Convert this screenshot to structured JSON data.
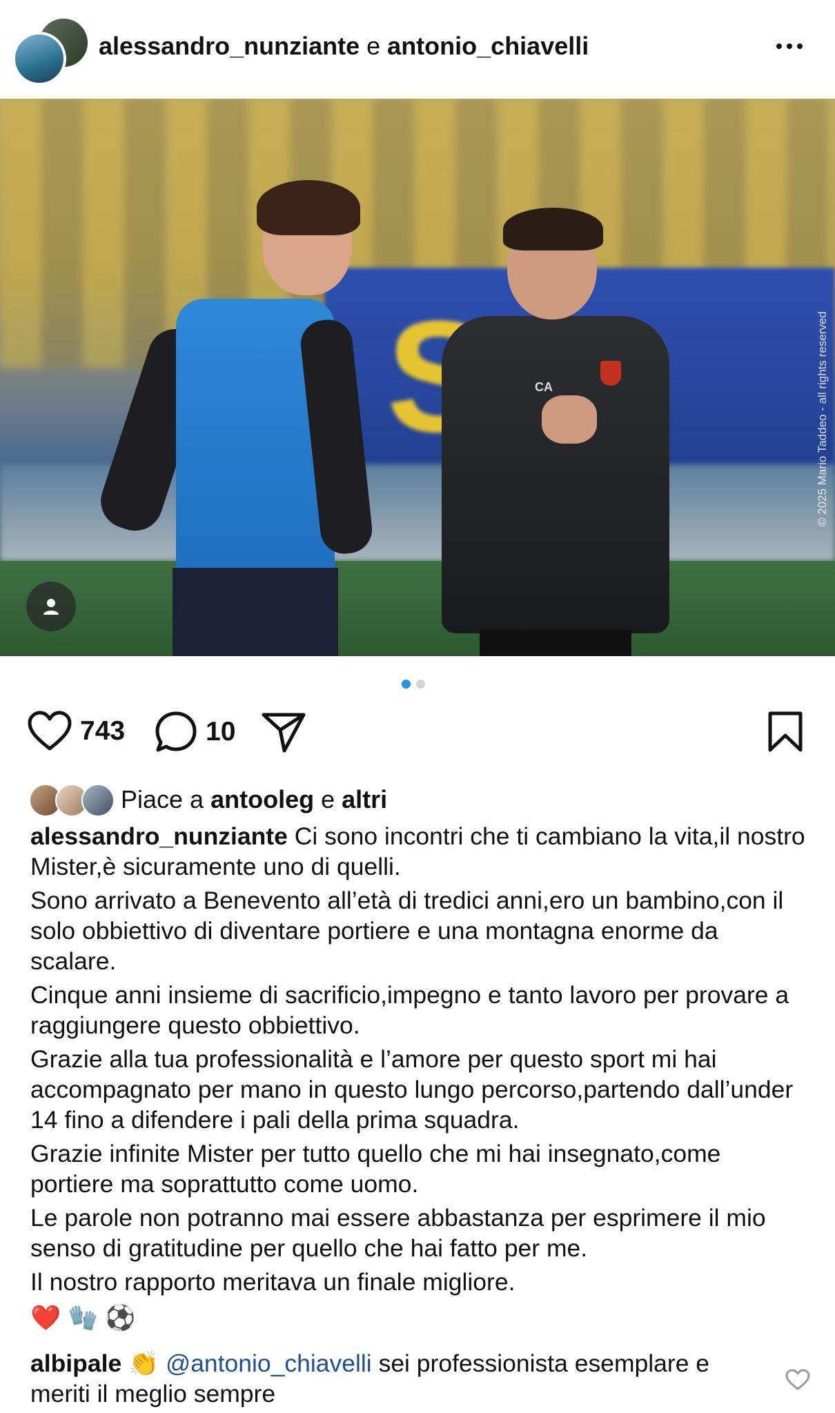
{
  "header": {
    "user1": "alessandro_nunziante",
    "conjunction": "e",
    "user2": "antonio_chiavelli"
  },
  "photo": {
    "watermark": "© 2025 Mario Taddeo - all rights reserved",
    "jacket_initials": "CA",
    "carousel": {
      "count": 2,
      "active": 1
    }
  },
  "actions": {
    "likes": "743",
    "comments": "10"
  },
  "liked_by": {
    "prefix": "Piace a",
    "user": "antooleg",
    "conjunction": "e",
    "others": "altri"
  },
  "caption": {
    "username": "alessandro_nunziante",
    "paragraphs": [
      "Ci sono incontri che ti cambiano la vita,il nostro Mister,è sicuramente uno di quelli.",
      "Sono arrivato a Benevento all’età di tredici anni,ero un bambino,con il solo obbiettivo di diventare portiere e una montagna enorme da scalare.",
      "Cinque anni insieme di sacrificio,impegno e tanto lavoro per provare a raggiungere questo obbiettivo.",
      "Grazie alla tua professionalità e l’amore per questo sport mi hai accompagnato per mano in questo lungo percorso,partendo dall’under 14 fino a difendere i pali della prima squadra.",
      "Grazie infinite Mister per tutto quello che mi hai insegnato,come portiere ma soprattutto come uomo.",
      "Le parole non potranno mai essere abbastanza per esprimere il mio senso di gratitudine per quello che hai fatto per me.",
      "Il nostro rapporto meritava un finale migliore."
    ],
    "emojis": [
      "❤️",
      "🧤",
      "⚽"
    ]
  },
  "comment": {
    "username": "albipale",
    "emoji": "👏",
    "mention": "@antonio_chiavelli",
    "text": "sei professionista esemplare e meriti il meglio sempre"
  },
  "icons": {
    "like": "heart-icon",
    "comment": "comment-bubble-icon",
    "share": "paper-plane-icon",
    "save": "bookmark-icon",
    "more": "more-dots-icon",
    "tag": "user-tag-icon",
    "comment_like": "small-heart-icon"
  },
  "colors": {
    "active_dot": "#2e8fe6",
    "inactive_dot": "#d4d4d4",
    "mention": "#1f4f8f"
  }
}
